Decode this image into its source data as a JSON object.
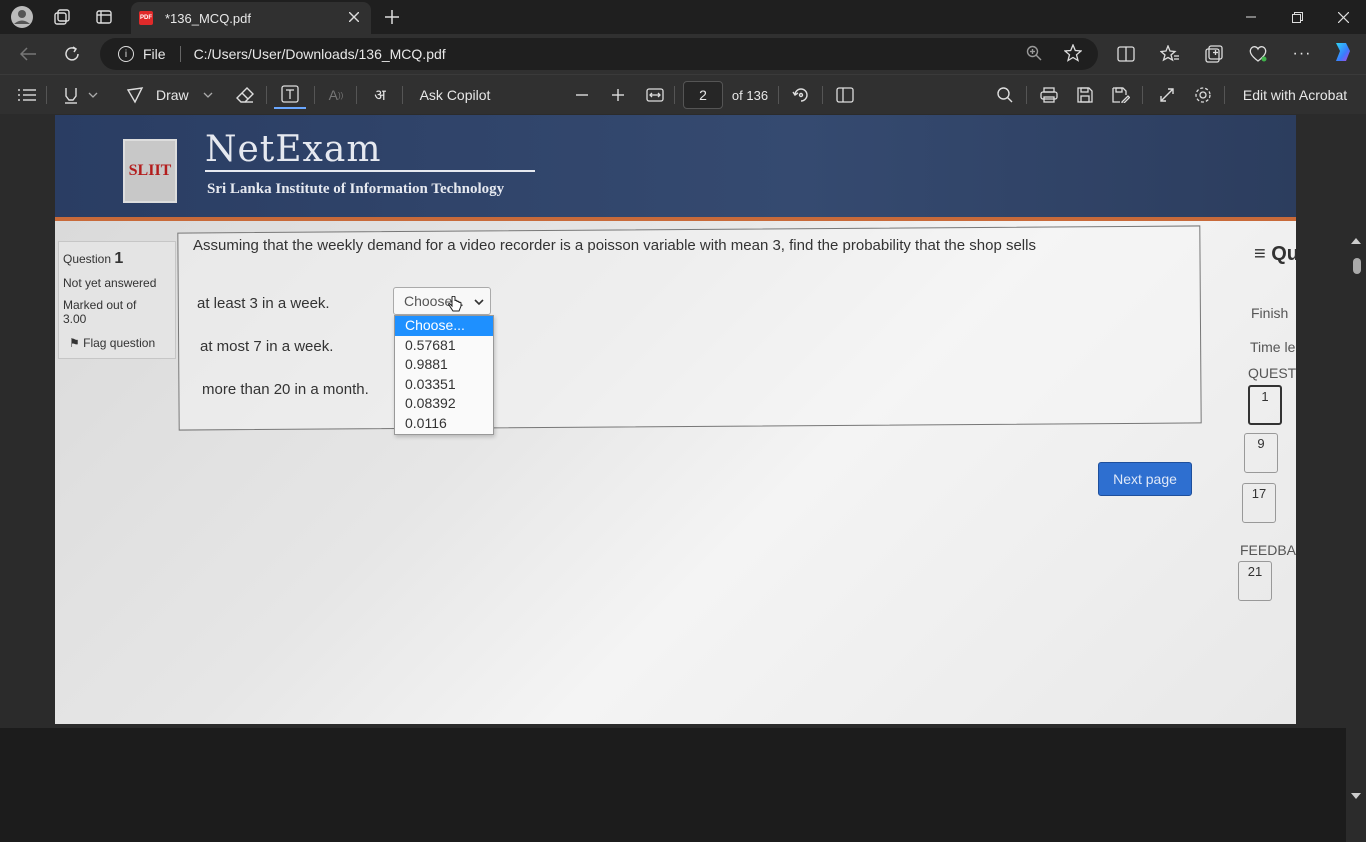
{
  "browser": {
    "tab_title": "*136_MCQ.pdf",
    "address_scheme": "File",
    "url": "C:/Users/User/Downloads/136_MCQ.pdf"
  },
  "pdf_toolbar": {
    "draw_label": "Draw",
    "copilot_label": "Ask Copilot",
    "page_number": "2",
    "page_total": "of 136",
    "acrobat_label": "Edit with Acrobat"
  },
  "page": {
    "brand": "NetExam",
    "logo_text": "SLIIT",
    "institute": "Sri Lanka Institute of Information Technology",
    "question_info": {
      "label": "Question",
      "number": "1",
      "status": "Not yet answered",
      "marks": "Marked out of 3.00",
      "flag": "Flag question"
    },
    "question_text": "Assuming that the weekly demand for a video recorder is a poisson variable with mean 3, find the probability that the shop sells",
    "rows": [
      "at least 3 in a week.",
      "at most 7 in a week.",
      "more than 20 in a month."
    ],
    "select_value": "Choose...",
    "options": [
      "Choose...",
      "0.57681",
      "0.9881",
      "0.03351",
      "0.08392",
      "0.0116"
    ],
    "next_button": "Next page",
    "nav": {
      "title": "≡ Qu",
      "finish": "Finish",
      "time": "Time le",
      "questions_label": "QUEST",
      "feedback_label": "FEEDBA",
      "numbers": [
        "1",
        "9",
        "17",
        "21"
      ]
    }
  }
}
